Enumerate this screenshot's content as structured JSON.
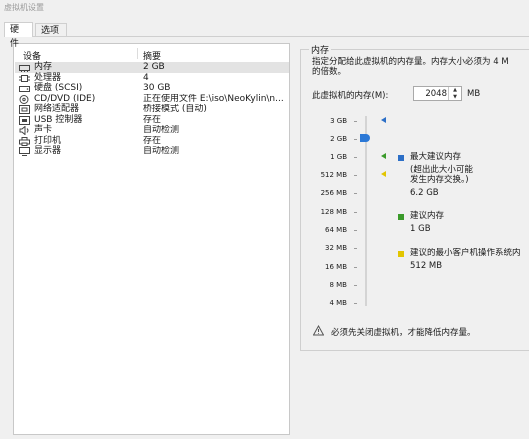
{
  "window": {
    "title": "虚拟机设置"
  },
  "tabs": [
    {
      "label": "硬件"
    },
    {
      "label": "选项"
    }
  ],
  "devices": {
    "header": {
      "device": "设备",
      "summary": "摘要"
    },
    "rows": [
      {
        "icon": "memory-icon",
        "name": "内存",
        "summary": "2 GB"
      },
      {
        "icon": "processor-icon",
        "name": "处理器",
        "summary": "4"
      },
      {
        "icon": "hard-disk-icon",
        "name": "硬盘 (SCSI)",
        "summary": "30 GB"
      },
      {
        "icon": "cd-dvd-icon",
        "name": "CD/DVD (IDE)",
        "summary": "正在使用文件 E:\\iso\\NeoKylin\\n..."
      },
      {
        "icon": "network-adapter-icon",
        "name": "网络适配器",
        "summary": "桥接模式 (自动)"
      },
      {
        "icon": "usb-controller-icon",
        "name": "USB 控制器",
        "summary": "存在"
      },
      {
        "icon": "sound-card-icon",
        "name": "声卡",
        "summary": "自动检测"
      },
      {
        "icon": "printer-icon",
        "name": "打印机",
        "summary": "存在"
      },
      {
        "icon": "display-icon",
        "name": "显示器",
        "summary": "自动检测"
      }
    ]
  },
  "memory": {
    "group_title": "内存",
    "description_line1": "指定分配给此虚拟机的内存量。内存大小必须为 4 M",
    "description_line2": "的倍数。",
    "field_label": "此虚拟机的内存(M):",
    "value": "2048",
    "unit": "MB",
    "scale": [
      "3 GB",
      "2 GB",
      "1 GB",
      "512 MB",
      "256 MB",
      "128 MB",
      "64 MB",
      "32 MB",
      "16 MB",
      "8 MB",
      "4 MB"
    ],
    "max_recommended": {
      "title": "最大建议内存",
      "note_line1": "(超出此大小可能",
      "note_line2": "发生内存交换。)",
      "value": "6.2 GB",
      "color": "#2c6fc7"
    },
    "recommended": {
      "title": "建议内存",
      "value": "1 GB",
      "color": "#3a9a2a"
    },
    "min_guest": {
      "title": "建议的最小客户机操作系统内",
      "value": "512 MB",
      "color": "#e2c500"
    },
    "warning": "必须先关闭虚拟机，才能降低内存量。"
  }
}
